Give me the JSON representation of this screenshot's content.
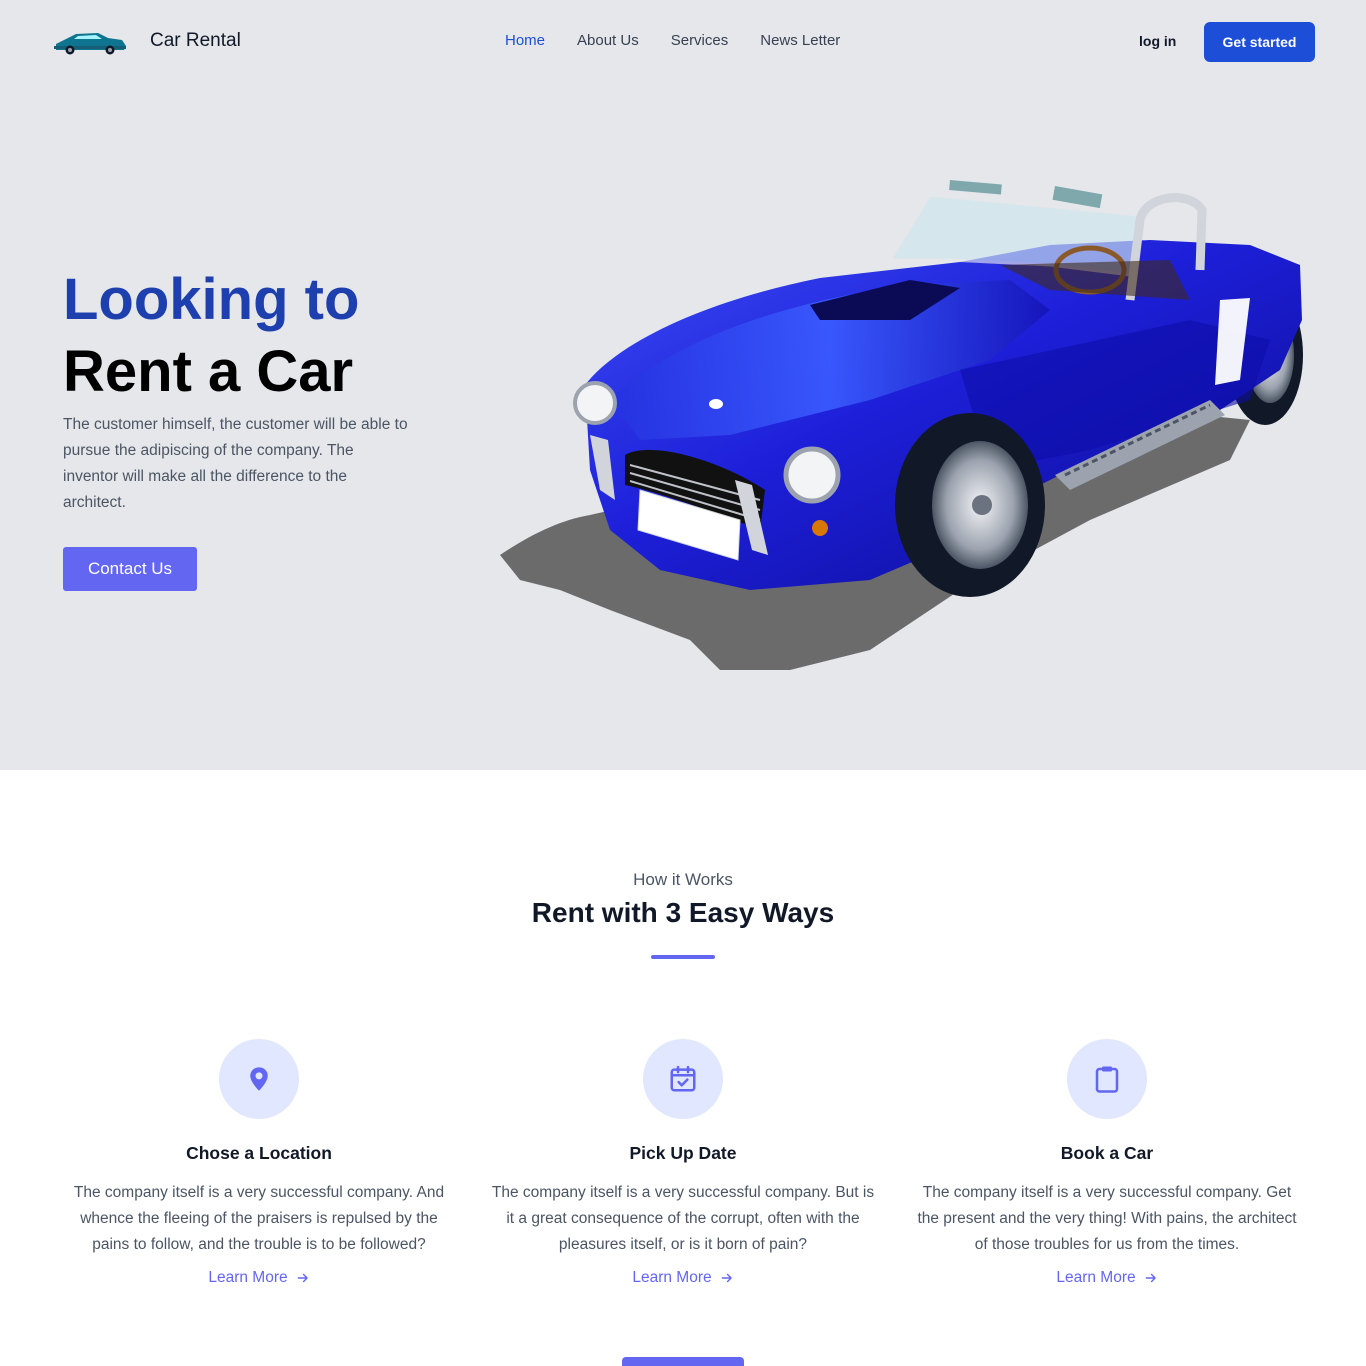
{
  "header": {
    "brand": "Car Rental",
    "logo_icon": "car-logo-icon",
    "nav": [
      {
        "label": "Home",
        "active": true
      },
      {
        "label": "About Us",
        "active": false
      },
      {
        "label": "Services",
        "active": false
      },
      {
        "label": "News Letter",
        "active": false
      }
    ],
    "login_label": "log in",
    "cta_label": "Get started"
  },
  "hero": {
    "headline_line1": "Looking to",
    "headline_line2": "Rent a Car",
    "description": "The customer himself, the customer will be able to pursue the adipiscing of the company. The inventor will make all the difference to the architect.",
    "contact_label": "Contact Us",
    "image": "blue-convertible-car-illustration"
  },
  "how_it_works": {
    "subtitle": "How it Works",
    "title": "Rent with 3 Easy Ways",
    "features": [
      {
        "icon": "location-pin-icon",
        "title": "Chose a Location",
        "text": "The company itself is a very successful company. And whence the fleeing of the praisers is repulsed by the pains to follow, and the trouble is to be followed?",
        "link": "Learn More"
      },
      {
        "icon": "calendar-check-icon",
        "title": "Pick Up Date",
        "text": "The company itself is a very successful company. But is it a great consequence of the corrupt, often with the pleasures itself, or is it born of pain?",
        "link": "Learn More"
      },
      {
        "icon": "clipboard-icon",
        "title": "Book a Car",
        "text": "The company itself is a very successful company. Get the present and the very thing! With pains, the architect of those troubles for us from the times.",
        "link": "Learn More"
      }
    ]
  },
  "colors": {
    "primary": "#1d4ed8",
    "accent": "#6366f1",
    "hero_bg": "#e5e7eb",
    "icon_bg": "#e0e7ff"
  }
}
